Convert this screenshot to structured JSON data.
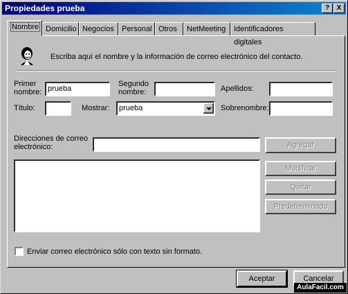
{
  "window": {
    "title": "Propiedades prueba",
    "help_glyph": "?",
    "close_glyph": "X"
  },
  "tabs": [
    {
      "label": "Nombre",
      "active": true
    },
    {
      "label": "Domicilio"
    },
    {
      "label": "Negocios"
    },
    {
      "label": "Personal"
    },
    {
      "label": "Otros"
    },
    {
      "label": "NetMeeting"
    },
    {
      "label": "Identificadores digitales"
    }
  ],
  "intro": {
    "icon": "contact-icon",
    "text": "Escriba aquí el nombre y la información de correo electrónico del contacto."
  },
  "form": {
    "first_name_label_1": "Primer",
    "first_name_label_2": "nombre:",
    "first_name_value": "prueba",
    "second_name_label_1": "Segundo",
    "second_name_label_2": "nombre:",
    "second_name_value": "",
    "lastname_label": "Apellidos:",
    "lastname_value": "",
    "title_label": "Título:",
    "title_value": "",
    "display_label": "Mostrar:",
    "display_value": "prueba",
    "nickname_label": "Sobrenombre:",
    "nickname_value": ""
  },
  "email": {
    "label_1": "Direcciones de correo",
    "label_2": "electrónico:",
    "input_value": "",
    "add_button": "Agregar",
    "modify_button": "Modificar",
    "remove_button": "Quitar",
    "default_button": "Predeterminado"
  },
  "plain_text_checkbox": {
    "label": "Enviar correo electrónico sólo con texto sin formato.",
    "checked": false
  },
  "footer": {
    "ok": "Aceptar",
    "cancel": "Cancelar"
  },
  "watermark": "AulaFacil.com"
}
